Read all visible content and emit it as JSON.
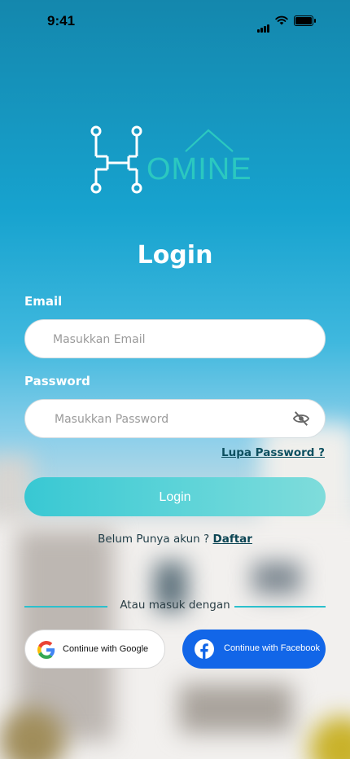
{
  "status_bar": {
    "time": "9:41"
  },
  "logo": {
    "text": "OMINE"
  },
  "title": "Login",
  "email": {
    "label": "Email",
    "placeholder": "Masukkan Email",
    "value": ""
  },
  "password": {
    "label": "Password",
    "placeholder": "Masukkan Password",
    "value": ""
  },
  "forgot_password": "Lupa Password ?",
  "login_button": "Login",
  "register": {
    "prompt": "Belum Punya akun ?",
    "link": "Daftar"
  },
  "divider_text": "Atau masuk dengan",
  "social": {
    "google": "Continue with Google",
    "facebook": "Continue with Facebook"
  },
  "colors": {
    "accent": "#2bc0cd",
    "facebook": "#1266e8",
    "link": "#0b4453"
  },
  "icons": [
    "signal-icon",
    "wifi-icon",
    "battery-icon",
    "eye-off-icon",
    "google-icon",
    "facebook-icon",
    "house-roof-icon"
  ]
}
